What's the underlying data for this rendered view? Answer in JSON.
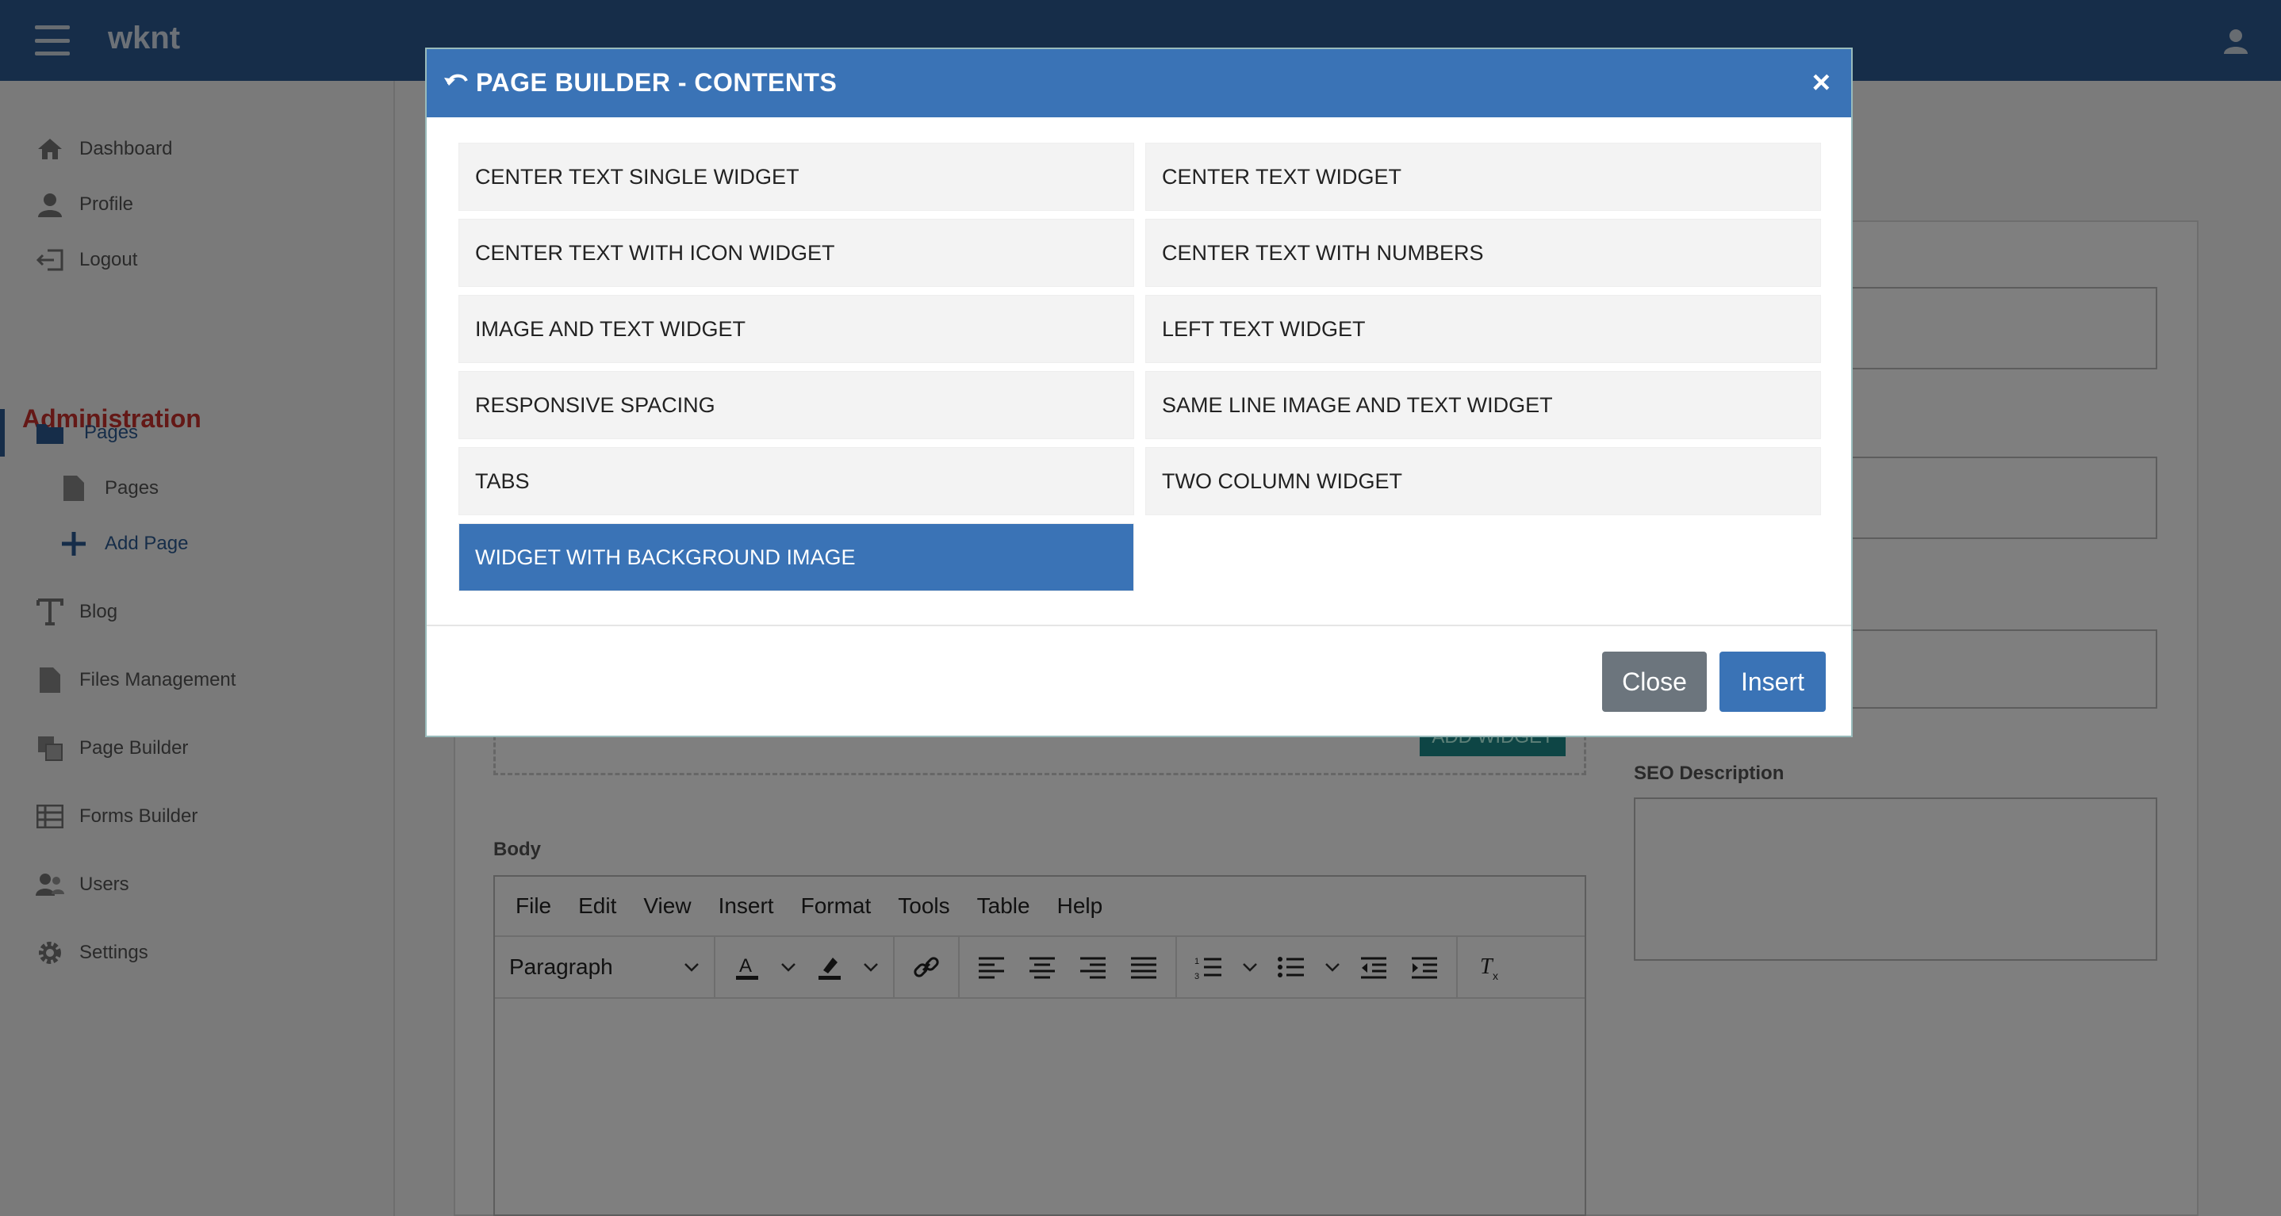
{
  "app": {
    "brand": "wknt"
  },
  "sidebar": {
    "items": [
      {
        "label": "Dashboard"
      },
      {
        "label": "Profile"
      },
      {
        "label": "Logout"
      }
    ],
    "section_title": "Administration",
    "admin_items": [
      {
        "label": "Pages"
      },
      {
        "label": "Pages"
      },
      {
        "label": "Add Page"
      },
      {
        "label": "Blog"
      },
      {
        "label": "Files Management"
      },
      {
        "label": "Page Builder"
      },
      {
        "label": "Forms Builder"
      },
      {
        "label": "Users"
      },
      {
        "label": "Settings"
      }
    ]
  },
  "main": {
    "add_widget_label": "ADD WIDGET",
    "body_label": "Body",
    "seo_description_label": "SEO Description",
    "editor": {
      "menu": [
        "File",
        "Edit",
        "View",
        "Insert",
        "Format",
        "Tools",
        "Table",
        "Help"
      ],
      "block_format": "Paragraph"
    }
  },
  "modal": {
    "title": "PAGE BUILDER - CONTENTS",
    "widgets": [
      {
        "label": "CENTER TEXT SINGLE WIDGET",
        "selected": false
      },
      {
        "label": "CENTER TEXT WIDGET",
        "selected": false
      },
      {
        "label": "CENTER TEXT WITH ICON WIDGET",
        "selected": false
      },
      {
        "label": "CENTER TEXT WITH NUMBERS",
        "selected": false
      },
      {
        "label": "IMAGE AND TEXT WIDGET",
        "selected": false
      },
      {
        "label": "LEFT TEXT WIDGET",
        "selected": false
      },
      {
        "label": "RESPONSIVE SPACING",
        "selected": false
      },
      {
        "label": "SAME LINE IMAGE AND TEXT WIDGET",
        "selected": false
      },
      {
        "label": "TABS",
        "selected": false
      },
      {
        "label": "TWO COLUMN WIDGET",
        "selected": false
      },
      {
        "label": "WIDGET WITH BACKGROUND IMAGE",
        "selected": true
      }
    ],
    "close_label": "Close",
    "insert_label": "Insert"
  },
  "colors": {
    "primary": "#3a73b6",
    "topbar": "#2c5a92",
    "admin_title": "#c9302c"
  }
}
